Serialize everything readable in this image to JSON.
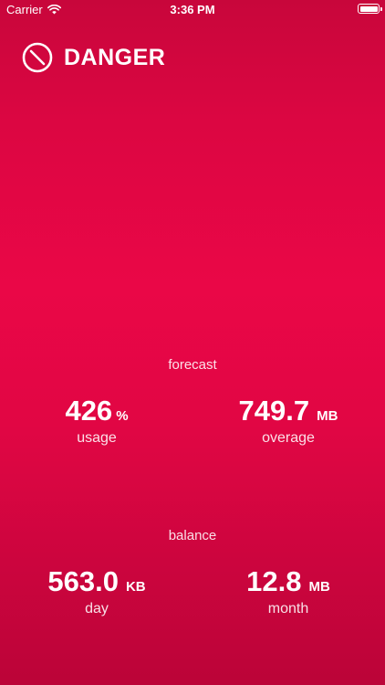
{
  "status_bar": {
    "carrier": "Carrier",
    "time": "3:36 PM",
    "icons": [
      "wifi-icon",
      "battery-icon"
    ]
  },
  "header": {
    "icon": "prohibited-icon",
    "title": "DANGER"
  },
  "forecast": {
    "label": "forecast",
    "usage": {
      "value": "426",
      "unit": "%",
      "caption": "usage"
    },
    "overage": {
      "value": "749.7",
      "unit": "MB",
      "caption": "overage"
    }
  },
  "balance": {
    "label": "balance",
    "day": {
      "value": "563.0",
      "unit": "KB",
      "caption": "day"
    },
    "month": {
      "value": "12.8",
      "unit": "MB",
      "caption": "month"
    }
  },
  "colors": {
    "background_top": "#c8063b",
    "background_mid": "#ea0747",
    "background_bottom": "#bb0438",
    "text": "#ffffff"
  }
}
